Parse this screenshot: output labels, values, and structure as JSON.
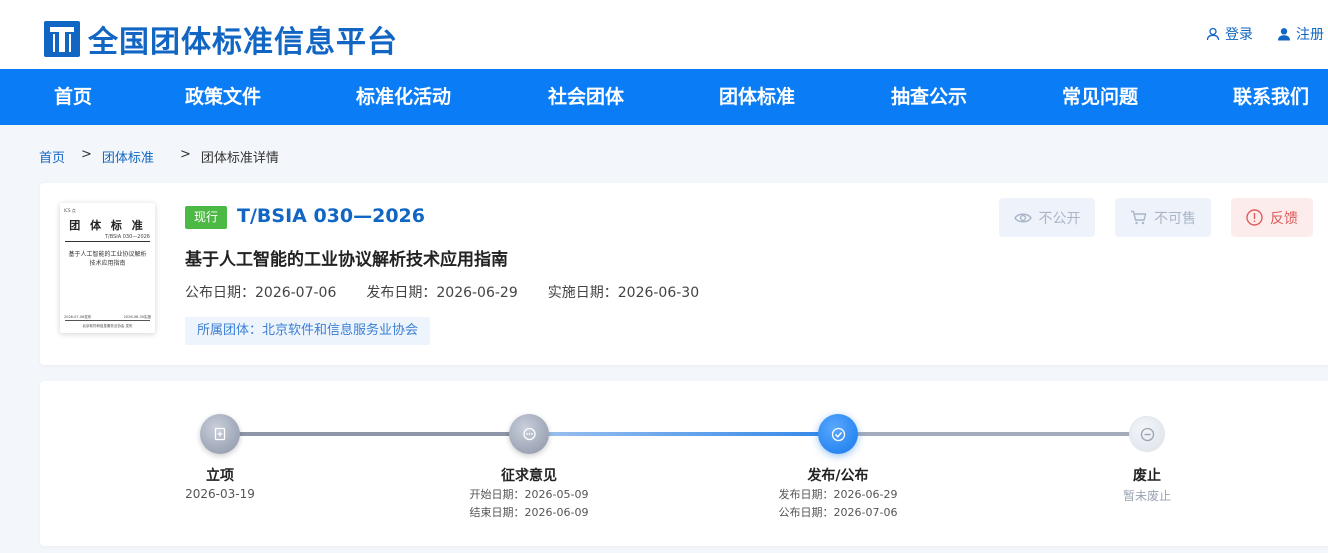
{
  "header": {
    "site_title": "全国团体标准信息平台",
    "login_label": "登录",
    "register_label": "注册"
  },
  "nav": {
    "items": [
      "首页",
      "政策文件",
      "标准化活动",
      "社会团体",
      "团体标准",
      "抽查公示",
      "常见问题",
      "联系我们"
    ]
  },
  "breadcrumb": {
    "home": "首页",
    "section": "团体标准",
    "current": "团体标准详情",
    "separator": ">"
  },
  "standard": {
    "status": "现行",
    "code": "T/BSIA 030—2026",
    "name": "基于人工智能的工业协议解析技术应用指南",
    "announce_date_label": "公布日期：2026-07-06",
    "publish_date_label": "发布日期：2026-06-29",
    "implement_date_label": "实施日期：2026-06-30",
    "organization_label": "所属团体：北京软件和信息服务业协会",
    "cover": {
      "top_text": "ICS  点",
      "title": "团 体 标 准",
      "code": "T/BSIA 030—2026",
      "name": "基于人工智能的工业协议解析技术应用指南",
      "publish_text": "2026-07-06发布",
      "implement_text": "2026-06-30实施",
      "org_text": "北京软件和信息服务业协会 发布"
    }
  },
  "actions": {
    "public_label": "不公开",
    "sale_label": "不可售",
    "feedback_label": "反馈",
    "colors": {
      "disabled": "#a9b6c8",
      "feedback": "#e25b5b"
    }
  },
  "progress": {
    "steps": [
      {
        "label": "立项",
        "date": "2026-03-19"
      },
      {
        "label": "征求意见",
        "sub1": "开始日期：2026-05-09",
        "sub2": "结束日期：2026-06-09"
      },
      {
        "label": "发布/公布",
        "sub1": "发布日期：2026-06-29",
        "sub2": "公布日期：2026-07-06"
      },
      {
        "label": "废止",
        "date": "暂未废止"
      }
    ],
    "active_step": 3
  },
  "colors": {
    "brand": "#1166c4",
    "nav": "#0a7cf5",
    "status_active": "#4cb944"
  }
}
